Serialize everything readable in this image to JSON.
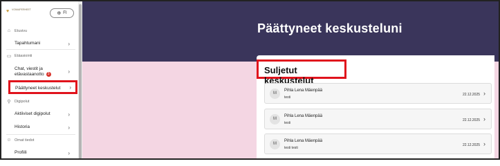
{
  "sidebar": {
    "logo_text": "VOIMAPERHEET",
    "language": "FI",
    "sections": {
      "home": "Etusivu",
      "scheduling": "Etäasiointi",
      "digipaths": "Digipolut",
      "own_info": "Omat tiedot"
    },
    "items": {
      "events": "Tapahtumani",
      "chat": "Chat, viestit ja",
      "chat_line2": "etävastaanotto",
      "chat_badge": "3",
      "ended": "Päättyneet keskustelut",
      "active_paths": "Aktiiviset digipolut",
      "history": "Historia",
      "profile": "Profiili"
    }
  },
  "main": {
    "title": "Päättyneet keskusteluni",
    "card_title": "Suljetut keskustelut",
    "conversations": [
      {
        "initial": "M",
        "name": "Pihla Lena Mäenpää",
        "subject": "testi",
        "date": "22.12.2025"
      },
      {
        "initial": "M",
        "name": "Pihla Lena Mäenpää",
        "subject": "testi",
        "date": "22.12.2025"
      },
      {
        "initial": "M",
        "name": "Pihla Lena Mäenpää",
        "subject": "testi testi",
        "date": "22.12.2025"
      }
    ]
  },
  "colors": {
    "hero_bg": "#3a355b",
    "main_bg": "#f4d6e3",
    "highlight": "#e0131c",
    "badge": "#d8342c"
  }
}
